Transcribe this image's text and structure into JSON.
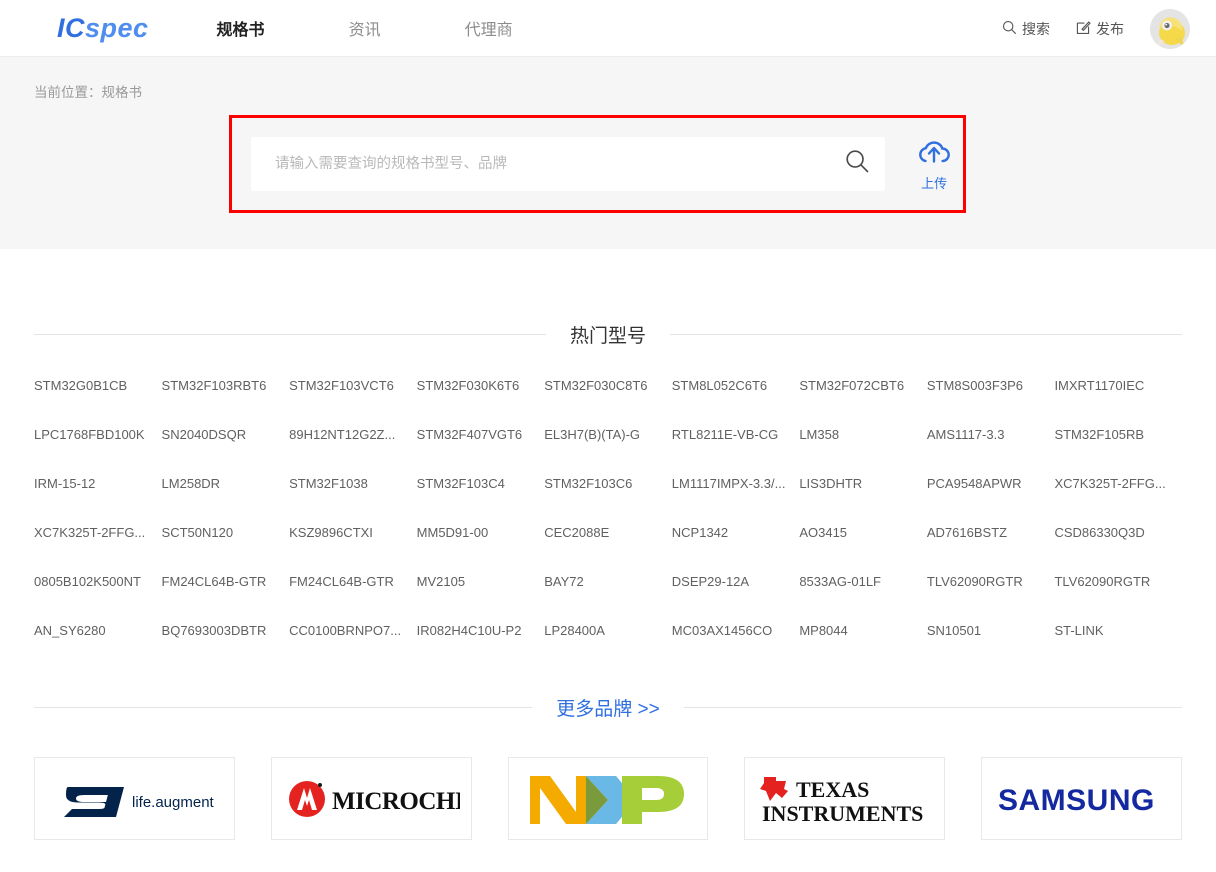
{
  "header": {
    "logo_ic": "IC",
    "logo_spec": "spec",
    "nav": [
      {
        "label": "规格书",
        "active": true
      },
      {
        "label": "资讯",
        "active": false
      },
      {
        "label": "代理商",
        "active": false
      }
    ],
    "search_action": "搜索",
    "publish_action": "发布",
    "avatar_name": "user-avatar"
  },
  "band": {
    "breadcrumb": "当前位置：规格书",
    "search_placeholder": "请输入需要查询的规格书型号、品牌",
    "search_value": "",
    "upload_label": "上传",
    "highlight_color": "#ff0000"
  },
  "hot_section": {
    "title": "热门型号",
    "parts": [
      "STM32G0B1CB",
      "STM32F103RBT6",
      "STM32F103VCT6",
      "STM32F030K6T6",
      "STM32F030C8T6",
      "STM8L052C6T6",
      "STM32F072CBT6",
      "STM8S003F3P6",
      "IMXRT1170IEC",
      "LPC1768FBD100K",
      "SN2040DSQR",
      "89H12NT12G2Z...",
      "STM32F407VGT6",
      "EL3H7(B)(TA)-G",
      "RTL8211E-VB-CG",
      "LM358",
      "AMS1117-3.3",
      "STM32F105RB",
      "IRM-15-12",
      "LM258DR",
      "STM32F1038",
      "STM32F103C4",
      "STM32F103C6",
      "LM1117IMPX-3.3/...",
      "LIS3DHTR",
      "PCA9548APWR",
      "XC7K325T-2FFG...",
      "XC7K325T-2FFG...",
      "SCT50N120",
      "KSZ9896CTXI",
      "MM5D91-00",
      "CEC2088E",
      "NCP1342",
      "AO3415",
      "AD7616BSTZ",
      "CSD86330Q3D",
      "0805B102K500NT",
      "FM24CL64B-GTR",
      "FM24CL64B-GTR",
      "MV2105",
      "BAY72",
      "DSEP29-12A",
      "8533AG-01LF",
      "TLV62090RGTR",
      "TLV62090RGTR",
      "AN_SY6280",
      "BQ7693003DBTR",
      "CC0100BRNPO7...",
      "IR082H4C10U-P2",
      "LP28400A",
      "MC03AX1456CO",
      "MP8044",
      "SN10501",
      "ST-LINK"
    ]
  },
  "brand_section": {
    "title": "更多品牌 >>",
    "brands": [
      {
        "name": "STMicroelectronics",
        "text": "life.augmented"
      },
      {
        "name": "Microchip",
        "text": "MICROCHIP"
      },
      {
        "name": "NXP",
        "text": "NXP"
      },
      {
        "name": "Texas Instruments",
        "text_top": "TEXAS",
        "text_bottom": "INSTRUMENTS"
      },
      {
        "name": "Samsung",
        "text": "SAMSUNG"
      }
    ]
  }
}
